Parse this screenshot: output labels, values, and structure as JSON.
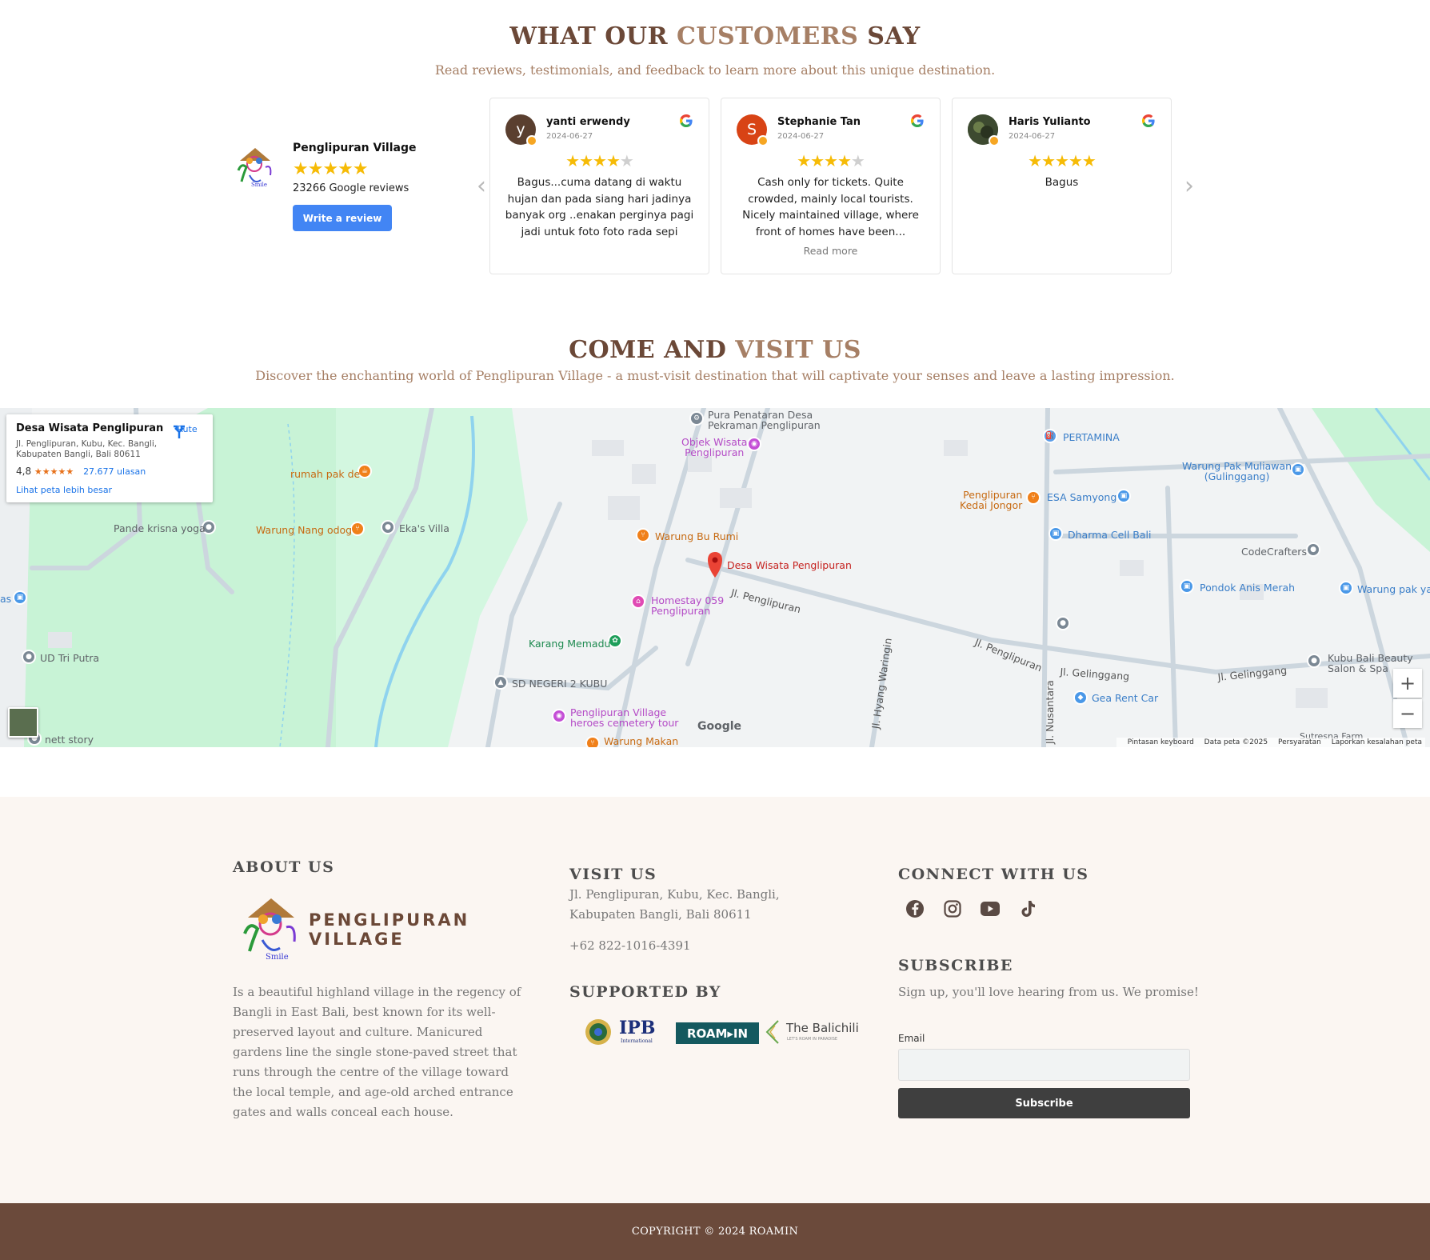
{
  "reviews_section": {
    "title_part1": "WHAT OUR",
    "title_part2": "CUSTOMERS",
    "title_part3": "SAY",
    "subtitle": "Read reviews, testimonials, and feedback to learn more about this unique destination."
  },
  "business": {
    "name": "Penglipuran Village",
    "stars": "★★★★★",
    "review_count": "23266 Google reviews",
    "write_review": "Write a review"
  },
  "reviews": [
    {
      "initial": "y",
      "name": "yanti erwendy",
      "date": "2024-06-27",
      "rating": 4,
      "text": "Bagus...cuma datang di waktu hujan dan pada siang hari jadinya banyak org ..enakan perginya pagi jadi untuk foto foto rada sepi",
      "more": ""
    },
    {
      "initial": "S",
      "name": "Stephanie Tan",
      "date": "2024-06-27",
      "rating": 4,
      "text": "Cash only for tickets. Quite crowded, mainly local tourists. Nicely maintained village, where front of homes have been...",
      "more": "Read more"
    },
    {
      "initial": "",
      "name": "Haris Yulianto",
      "date": "2024-06-27",
      "rating": 5,
      "text": "Bagus",
      "more": ""
    }
  ],
  "visit_section": {
    "title_part1": "COME AND",
    "title_part2": "VISIT US",
    "subtitle": "Discover the enchanting world of Penglipuran Village - a must-visit destination that will captivate your senses and leave a lasting impression."
  },
  "map": {
    "place_title": "Desa Wisata Penglipuran",
    "place_address": "Jl. Penglipuran, Kubu, Kec. Bangli, Kabupaten Bangli, Bali 80611",
    "rating": "4,8",
    "rating_stars": "★★★★★",
    "rating_count": "27.677 ulasan",
    "bigger_map": "Lihat peta lebih besar",
    "directions": "Rute",
    "labels": {
      "pura": "Pura Penataran Desa\nPekraman Penglipuran",
      "objek": "Objek Wisata\nPenglipuran",
      "pertamina": "PERTAMINA",
      "muliawan": "Warung Pak Muliawan\n(Gulinggang)",
      "rumah": "rumah pak de",
      "kedai": "Penglipuran\nKedai Jongor",
      "esa": "ESA Samyong",
      "pande": "Pande krisna yoga",
      "nang": "Warung Nang odog",
      "eka": "Eka's Villa",
      "burumi": "Warung Bu Rumi",
      "dharma": "Dharma Cell Bali",
      "codecrafters": "CodeCrafters",
      "desa": "Desa Wisata Penglipuran",
      "jl_peng1": "Jl. Penglipuran",
      "homestay": "Homestay 059\nPenglipuran",
      "anis": "Pondok Anis Merah",
      "paksas": "Warung pak yas",
      "as": "as",
      "karang": "Karang Memadu",
      "tri": "UD Tri Putra",
      "hyang": "Jl. Hyang Waringin",
      "jl_peng2": "Jl. Penglipuran",
      "gel1": "Jl. Gelinggang",
      "gel2": "Jl. Gelinggang",
      "kubu": "Kubu Bali Beauty\nSalon & Spa",
      "sdn": "SD NEGERI 2 KUBU",
      "gea": "Gea Rent Car",
      "nusantara": "Jl. Nusantara",
      "heroes": "Penglipuran Village\nheroes cemetery tour",
      "makan": "Warung Makan",
      "story": "nett story",
      "sutresna": "Sutresna Farm",
      "google": "Google"
    },
    "zoom_in": "+",
    "zoom_out": "−",
    "footer_shortcuts": "Pintasan keyboard",
    "footer_data": "Data peta ©2025",
    "footer_terms": "Persyaratan",
    "footer_report": "Laporkan kesalahan peta"
  },
  "footer": {
    "about_title": "ABOUT US",
    "logo_line1": "PENGLIPURAN",
    "logo_line2": "VILLAGE",
    "about_text": "Is a beautiful highland village in the regency of Bangli in East Bali, best known for its well-preserved layout and culture. Manicured gardens line the single stone-paved street that runs through the centre of the village toward the local temple, and age-old arched entrance gates and walls conceal each house.",
    "visit_title": "VISIT US",
    "address": "Jl. Penglipuran, Kubu, Kec. Bangli, Kabupaten Bangli, Bali 80611",
    "phone": "+62 822-1016-4391",
    "supported_title": "SUPPORTED BY",
    "sponsor_ipb": "IPB",
    "sponsor_ipb_sub": "International",
    "sponsor_roamin": "ROAM▸IN",
    "sponsor_balichili": "The Balichili",
    "sponsor_balichili_sub": "LET'S ROAM IN PARADISE",
    "connect_title": "CONNECT WITH US",
    "subscribe_title": "SUBSCRIBE",
    "subscribe_text": "Sign up, you'll love hearing from us. We promise!",
    "email_label": "Email",
    "subscribe_button": "Subscribe",
    "copyright": "COPYRIGHT © 2024 ROAMIN"
  },
  "colors": {
    "brown": "#6b4837",
    "tan": "#a67f65",
    "google_blue": "#4285f4",
    "star": "#f6bb06",
    "footer_bg": "#fbf6f2",
    "copy_bg": "#6b4a3b"
  }
}
